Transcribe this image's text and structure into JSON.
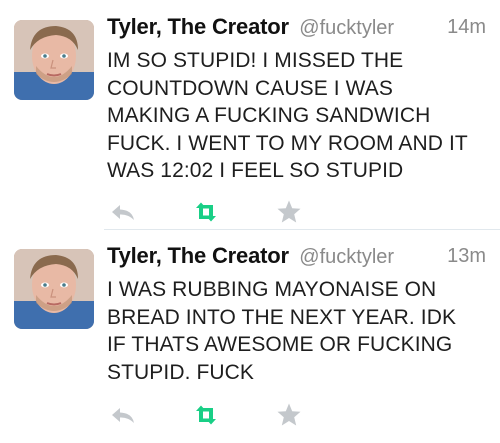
{
  "tweets": [
    {
      "author": "Tyler, The Creator",
      "handle": "@fucktyler",
      "time": "14m",
      "lines": [
        "IM SO STUPID! I MISSED THE",
        "COUNTDOWN CAUSE I WAS",
        "MAKING A FUCKING SANDWICH",
        "FUCK. I WENT TO MY ROOM AND IT",
        "WAS 12:02 I FEEL SO STUPID"
      ],
      "icons": {
        "reply": "reply-icon",
        "retweet": "retweet-icon",
        "favorite": "favorite-star-icon"
      }
    },
    {
      "author": "Tyler, The Creator",
      "handle": "@fucktyler",
      "time": "13m",
      "lines": [
        "I WAS RUBBING MAYONAISE ON",
        "BREAD INTO THE NEXT YEAR. IDK",
        "IF THATS AWESOME OR FUCKING",
        "STUPID. FUCK"
      ],
      "icons": {
        "reply": "reply-icon",
        "retweet": "retweet-icon",
        "favorite": "favorite-star-icon"
      }
    }
  ],
  "colors": {
    "text": "#1e1e1e",
    "secondary": "#8a8a8a",
    "icon_gray": "#c4c8cc",
    "retweet_green": "#19cf86",
    "divider": "#e1e8ed"
  }
}
